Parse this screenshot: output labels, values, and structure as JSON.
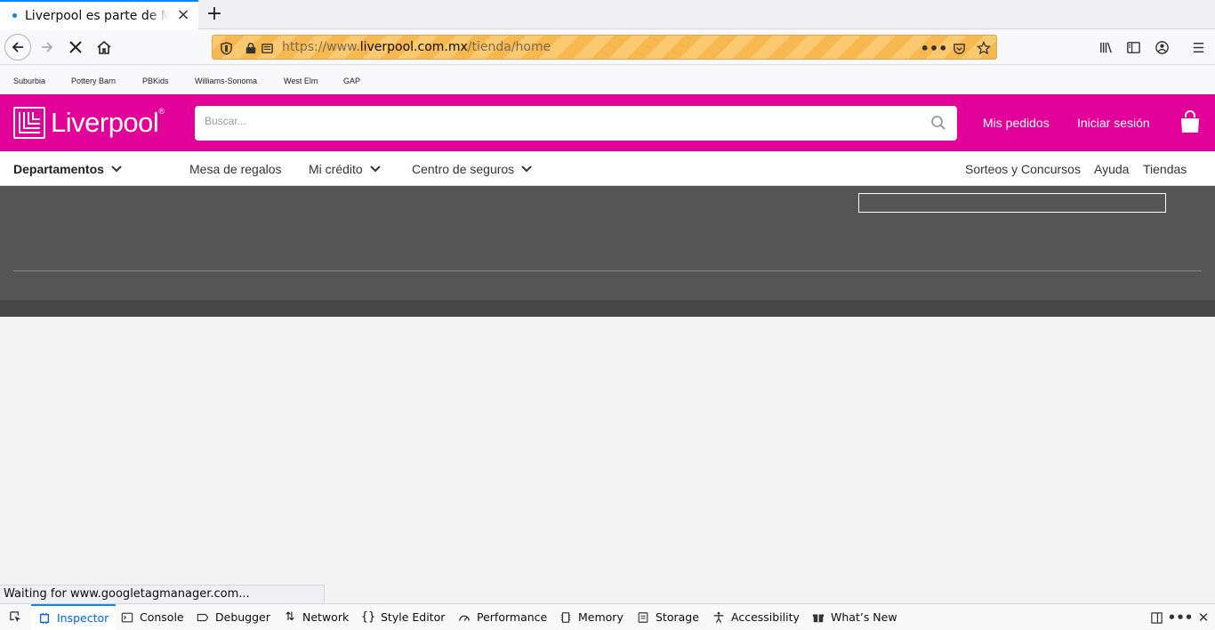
{
  "browser": {
    "tab_title": "Liverpool es parte de Mi",
    "url_prefix": "https://www.",
    "url_host": "liverpool.com.mx",
    "url_path": "/tienda/home",
    "status_text": "Waiting for www.googletagmanager.com..."
  },
  "bookmarks": [
    "Suburbia",
    "Pottery Barn",
    "PBKids",
    "Williams-Sonoma",
    "West Elm",
    "GAP"
  ],
  "header": {
    "logo_text": "Liverpool",
    "logo_reg": "®",
    "search_placeholder": "Buscar...",
    "orders_label": "Mis pedidos",
    "login_label": "Iniciar sesión"
  },
  "subnav": {
    "departments": "Departamentos",
    "registry": "Mesa de regalos",
    "credit": "Mi crédito",
    "insurance": "Centro de seguros",
    "contests": "Sorteos y Concursos",
    "help": "Ayuda",
    "stores": "Tiendas"
  },
  "devtools": {
    "tabs": [
      "Inspector",
      "Console",
      "Debugger",
      "Network",
      "Style Editor",
      "Performance",
      "Memory",
      "Storage",
      "Accessibility",
      "What’s New"
    ]
  },
  "colors": {
    "brand": "#e10098",
    "overlay": "#555555",
    "devtools_active": "#0060df"
  }
}
